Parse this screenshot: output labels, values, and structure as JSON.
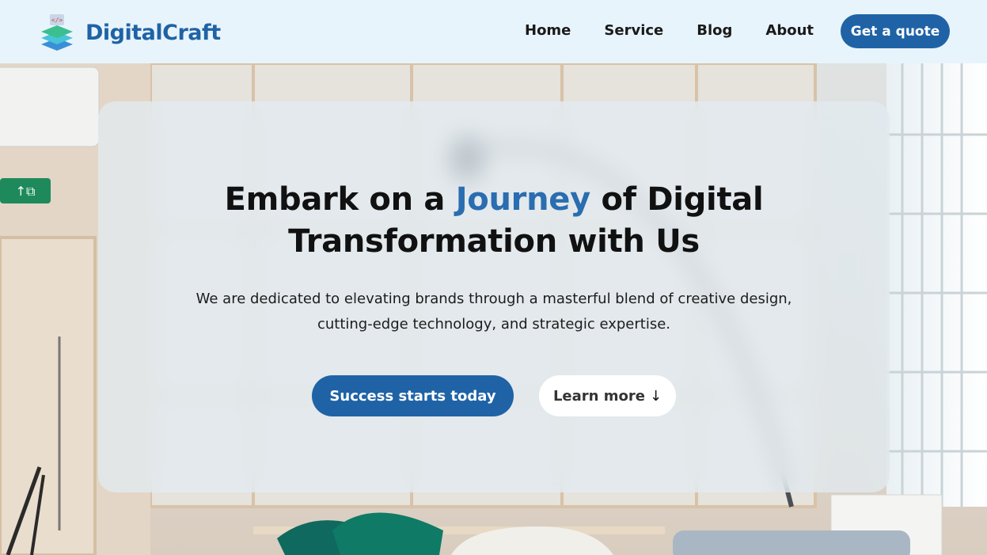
{
  "brand": {
    "name": "DigitalCraft",
    "logo_icon": "layers-code-icon",
    "color": "#1f63a6"
  },
  "nav": {
    "items": [
      {
        "label": "Home"
      },
      {
        "label": "Service"
      },
      {
        "label": "Blog"
      },
      {
        "label": "About"
      }
    ],
    "cta_label": "Get a quote"
  },
  "hero": {
    "headline_part1": "Embark on a ",
    "headline_accent": "Journey",
    "headline_part2": " of Digital Transformation with Us",
    "accent_color": "#2a6db0",
    "subtext": "We are dedicated to elevating brands through a masterful blend of creative design, cutting-edge technology, and strategic expertise.",
    "primary_button": "Success starts today",
    "secondary_button": "Learn more",
    "secondary_button_icon": "↓",
    "background": "office-interior-photo"
  }
}
